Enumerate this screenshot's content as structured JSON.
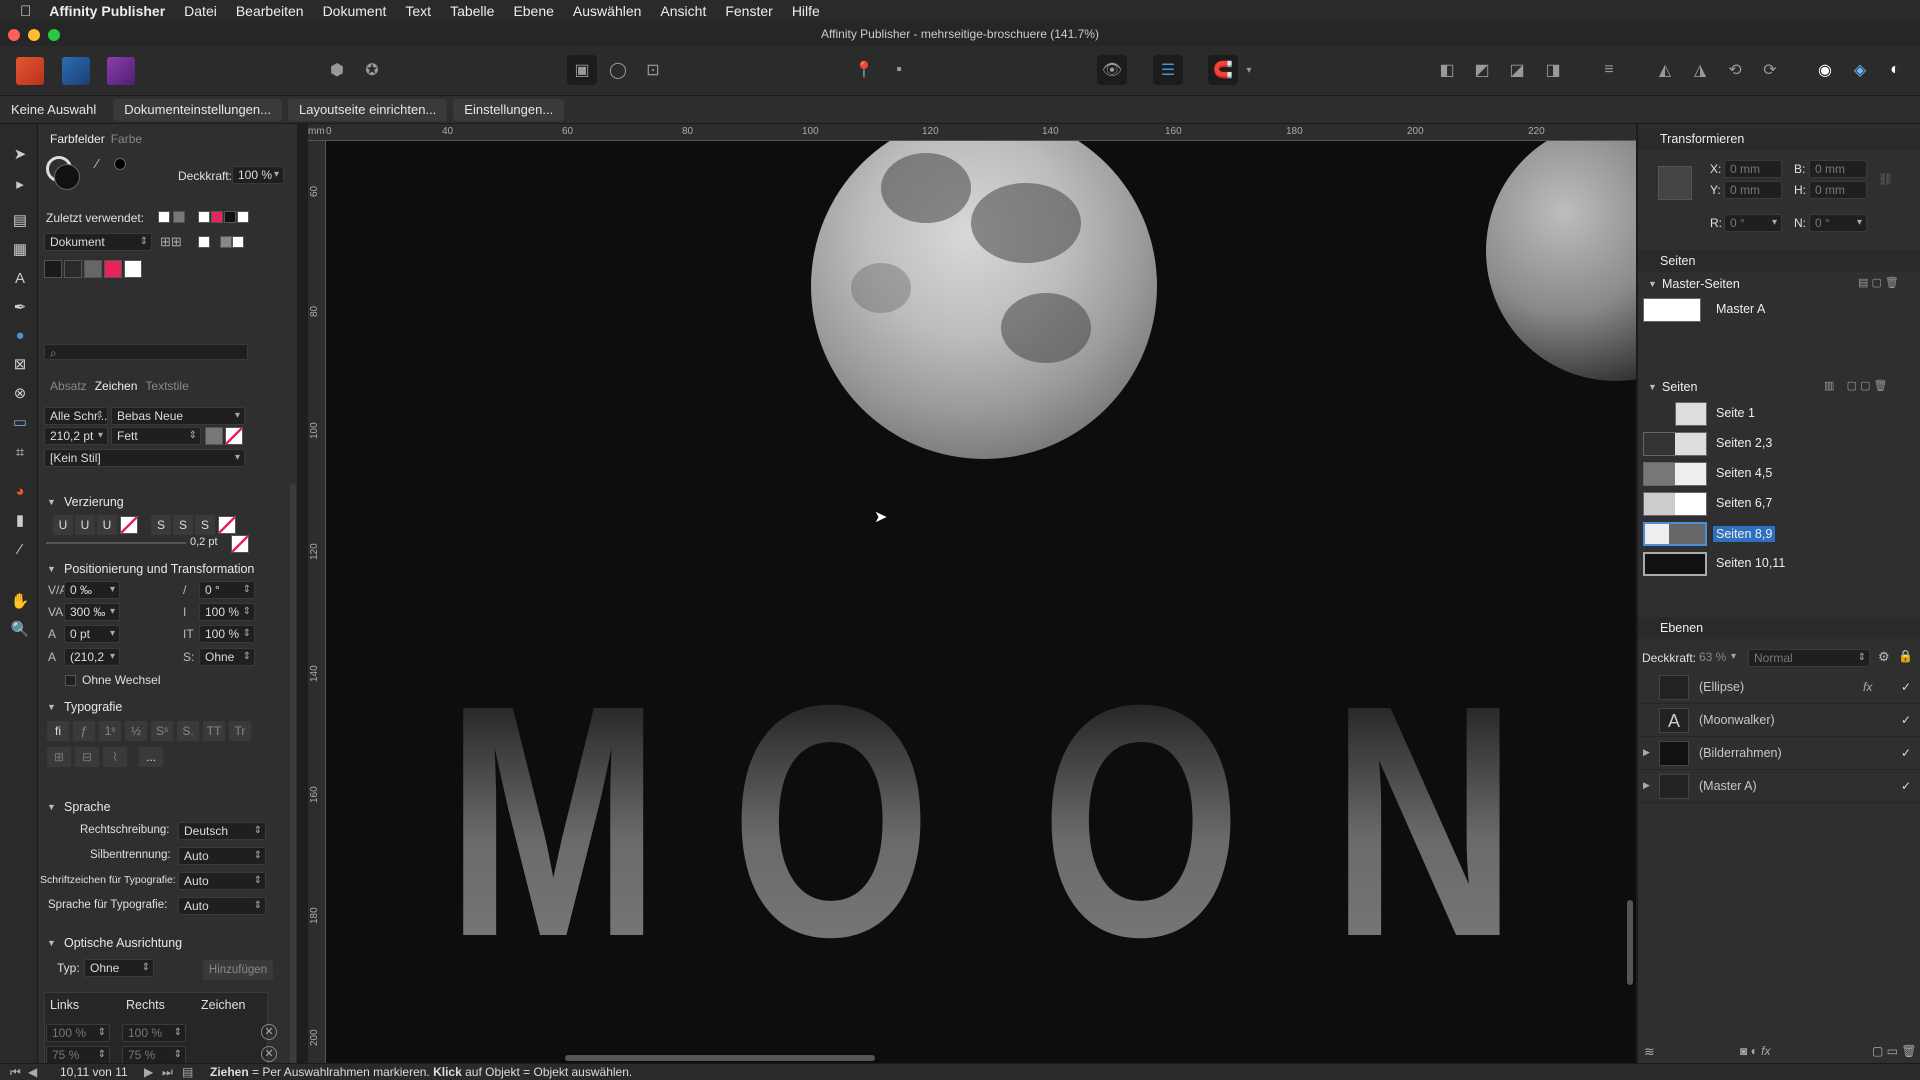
{
  "menubar": {
    "app": "Affinity Publisher",
    "items": [
      "Datei",
      "Bearbeiten",
      "Dokument",
      "Text",
      "Tabelle",
      "Ebene",
      "Auswählen",
      "Ansicht",
      "Fenster",
      "Hilfe"
    ]
  },
  "window": {
    "title": "Affinity Publisher - mehrseitige-broschuere (141.7%)"
  },
  "context": {
    "selection": "Keine Auswahl",
    "doc_settings": "Dokumenteinstellungen...",
    "layout_setup": "Layoutseite einrichten...",
    "settings": "Einstellungen..."
  },
  "swatches": {
    "tab_active": "Farbfelder",
    "tab_other": "Farbe",
    "opacity_label": "Deckkraft:",
    "opacity_value": "100 %",
    "recent_label": "Zuletzt verwendet:",
    "palette": "Dokument",
    "accent": "#e8245a"
  },
  "character": {
    "tabs": [
      "Absatz",
      "Zeichen",
      "Textstile"
    ],
    "font_collection": "Alle Schr...",
    "font_family": "Bebas Neue",
    "font_size": "210,2 pt",
    "font_style": "Fett",
    "text_style": "[Kein Stil]"
  },
  "decoration": {
    "title": "Verzierung",
    "stroke_value": "0,2 pt"
  },
  "positioning": {
    "title": "Positionierung und Transformation",
    "kerning": "0 ‰",
    "tracking": "300 ‰",
    "baseline": "0 pt",
    "leading": "(210,2",
    "shear": "0 °",
    "v_scale": "100 %",
    "h_scale": "100 %",
    "style": "Ohne",
    "no_break": "Ohne Wechsel"
  },
  "typography": {
    "title": "Typografie",
    "more": "..."
  },
  "language": {
    "title": "Sprache",
    "spelling_label": "Rechtschreibung:",
    "spelling": "Deutsch",
    "hyphen_label": "Silbentrennung:",
    "hyphen": "Auto",
    "glyph_label": "Schriftzeichen für Typografie:",
    "glyph": "Auto",
    "lang_label": "Sprache für Typografie:",
    "lang": "Auto"
  },
  "optical": {
    "title": "Optische Ausrichtung",
    "type_label": "Typ:",
    "type": "Ohne",
    "add": "Hinzufügen",
    "cols": [
      "Links",
      "Rechts",
      "Zeichen"
    ],
    "row1": [
      "100 %",
      "100 %"
    ],
    "row2": [
      "75 %",
      "75 %"
    ]
  },
  "ruler": {
    "top": [
      "0",
      "40",
      "60",
      "80",
      "100",
      "120",
      "140",
      "160",
      "180",
      "200",
      "220"
    ],
    "unit": "mm",
    "left": [
      "60",
      "80",
      "100",
      "120",
      "140",
      "160",
      "180",
      "200"
    ]
  },
  "canvas": {
    "letters": [
      "M",
      "O",
      "O",
      "N"
    ]
  },
  "transform": {
    "title": "Transformieren",
    "x_label": "X:",
    "x": "0 mm",
    "y_label": "Y:",
    "y": "0 mm",
    "w_label": "B:",
    "w": "0 mm",
    "h_label": "H:",
    "h": "0 mm",
    "r_label": "R:",
    "r": "0 °",
    "s_label": "N:",
    "s": "0 °"
  },
  "pages": {
    "title": "Seiten",
    "master_title": "Master-Seiten",
    "master": "Master A",
    "pages_title": "Seiten",
    "list": [
      "Seite 1",
      "Seiten 2,3",
      "Seiten 4,5",
      "Seiten 6,7",
      "Seiten 8,9",
      "Seiten 10,11"
    ],
    "selected": "Seiten 8,9"
  },
  "layers": {
    "title": "Ebenen",
    "opacity_label": "Deckkraft:",
    "opacity": "63 %",
    "blend": "Normal",
    "list": [
      "(Ellipse)",
      "(Moonwalker)",
      "(Bilderrahmen)",
      "(Master A)"
    ]
  },
  "status": {
    "page": "10,11 von 11",
    "bold1": "Ziehen",
    "text1": " = Per Auswahlrahmen markieren. ",
    "bold2": "Klick",
    "text2": " auf Objekt = Objekt auswählen."
  }
}
